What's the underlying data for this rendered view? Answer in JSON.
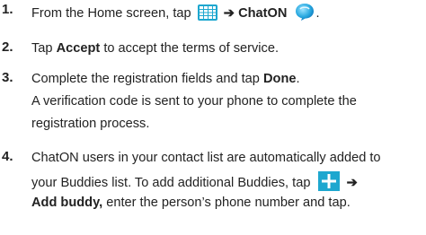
{
  "steps": [
    {
      "num": "1.",
      "pre": "From the Home screen, tap",
      "arrow": "➔",
      "target": "ChatON",
      "end": "."
    },
    {
      "num": "2.",
      "pre": "Tap",
      "bold": "Accept",
      "post": "to accept the terms of service."
    },
    {
      "num": "3.",
      "pre": "Complete the registration fields and tap",
      "bold": "Done",
      "end": ".",
      "line2": "A verification code is sent to your phone to complete the",
      "line3": "registration process."
    },
    {
      "num": "4.",
      "line1": "ChatON users in your contact list are automatically added to",
      "line2": "your Buddies list. To add additional Buddies, tap",
      "arrow": "➔",
      "line3_bold": "Add buddy,",
      "line3_rest": "enter the person’s phone number and tap."
    }
  ],
  "icons": {
    "apps": "apps-grid-icon",
    "chaton": "chaton-logo-icon",
    "add": "plus-icon",
    "color": "#1ea7cf"
  }
}
